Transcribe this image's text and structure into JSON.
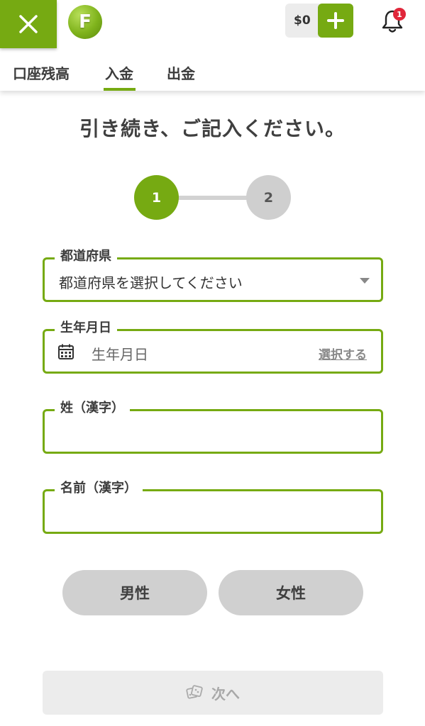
{
  "header": {
    "close_icon": "close-icon",
    "logo_letter": "F",
    "balance": "$0",
    "add_icon": "plus-icon",
    "notification_count": "1",
    "accent_color": "#76aa12",
    "badge_color": "#e0263a"
  },
  "tabs": [
    {
      "label": "口座残高"
    },
    {
      "label": "入金",
      "active": true
    },
    {
      "label": "出金"
    }
  ],
  "title": "引き続き、ご記入ください。",
  "stepper": {
    "steps": [
      "1",
      "2"
    ],
    "current": 1
  },
  "form": {
    "prefecture": {
      "label": "都道府県",
      "value": "都道府県を選択してください"
    },
    "birthdate": {
      "label": "生年月日",
      "placeholder": "生年月日",
      "action": "選択する"
    },
    "last_name": {
      "label": "姓（漢字）",
      "value": ""
    },
    "first_name": {
      "label": "名前（漢字）",
      "value": ""
    }
  },
  "gender": {
    "male": "男性",
    "female": "女性"
  },
  "next_button": {
    "label": "次へ",
    "icon": "dice-icon"
  }
}
